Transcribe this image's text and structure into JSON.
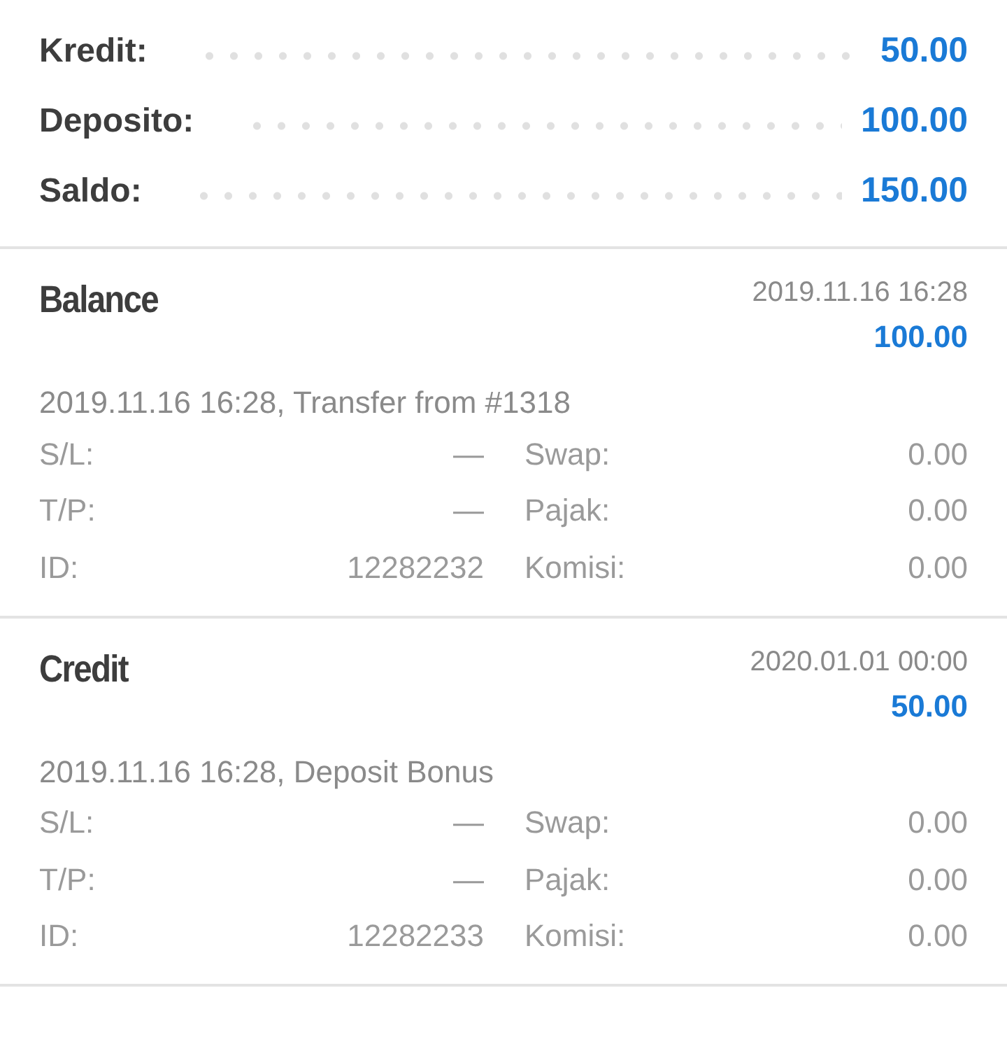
{
  "summary": [
    {
      "label": "Kredit:",
      "value": "50.00"
    },
    {
      "label": "Deposito:",
      "value": "100.00"
    },
    {
      "label": "Saldo:",
      "value": "150.00"
    }
  ],
  "entries": [
    {
      "title": "Balance",
      "time": "2019.11.16 16:28",
      "amount": "100.00",
      "comment": "2019.11.16 16:28, Transfer from #1318",
      "fields": [
        {
          "label": "S/L:",
          "value": "—",
          "label2": "Swap:",
          "value2": "0.00"
        },
        {
          "label": "T/P:",
          "value": "—",
          "label2": "Pajak:",
          "value2": "0.00"
        },
        {
          "label": "ID:",
          "value": "12282232",
          "label2": "Komisi:",
          "value2": "0.00"
        }
      ]
    },
    {
      "title": "Credit",
      "time": "2020.01.01 00:00",
      "amount": "50.00",
      "comment": "2019.11.16 16:28, Deposit Bonus",
      "fields": [
        {
          "label": "S/L:",
          "value": "—",
          "label2": "Swap:",
          "value2": "0.00"
        },
        {
          "label": "T/P:",
          "value": "—",
          "label2": "Pajak:",
          "value2": "0.00"
        },
        {
          "label": "ID:",
          "value": "12282233",
          "label2": "Komisi:",
          "value2": "0.00"
        }
      ]
    }
  ]
}
